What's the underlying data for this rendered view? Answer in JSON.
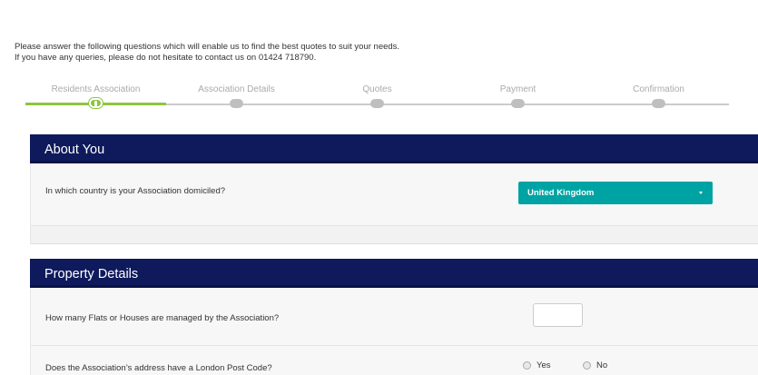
{
  "intro": {
    "line1": "Please answer the following questions which will enable us to find the best quotes to suit your needs.",
    "line2": "If you have any queries, please do not hesitate to contact us on 01424 718790."
  },
  "progress": {
    "steps": [
      {
        "label": "Residents Association",
        "active": true
      },
      {
        "label": "Association Details",
        "active": false
      },
      {
        "label": "Quotes",
        "active": false
      },
      {
        "label": "Payment",
        "active": false
      },
      {
        "label": "Confirmation",
        "active": false
      }
    ],
    "active_color": "#8dc63f",
    "inactive_color": "#bfbfbf"
  },
  "about": {
    "title": "About You",
    "question": "In which country is your Association domiciled?",
    "country_select": {
      "selected": "United Kingdom",
      "color": "#00a3a3"
    }
  },
  "property": {
    "title": "Property Details",
    "flats_question": "How many Flats or Houses are managed by the Association?",
    "flats_value": "",
    "postcode_question": "Does the Association’s address have a London Post Code?",
    "yes_label": "Yes",
    "no_label": "No"
  },
  "colors": {
    "header_bg": "#0f1a5c",
    "accent": "#8dc63f"
  }
}
